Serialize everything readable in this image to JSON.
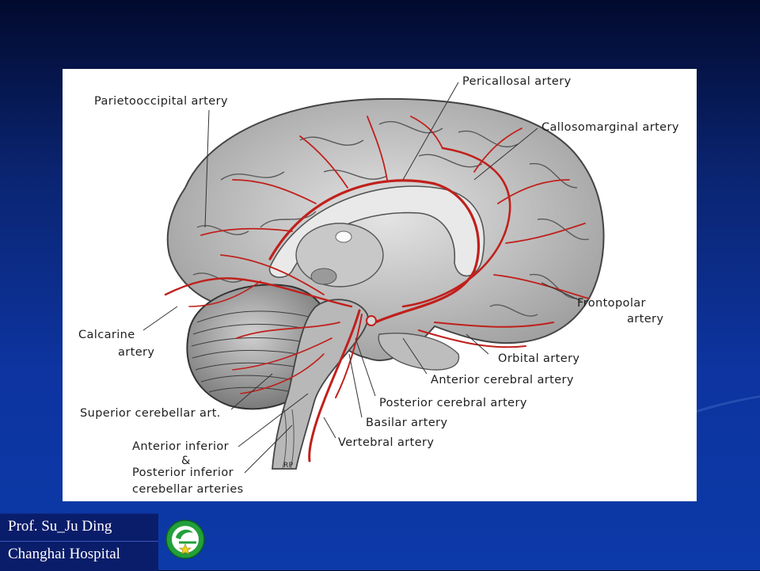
{
  "labels": {
    "pericallosal": "Pericallosal artery",
    "parietooccipital": "Parietooccipital artery",
    "callosomarginal": "Callosomarginal artery",
    "frontopolar_1": "Frontopolar",
    "frontopolar_2": "artery",
    "calcarine_1": "Calcarine",
    "calcarine_2": "artery",
    "orbital": "Orbital artery",
    "anterior_cerebral": "Anterior cerebral artery",
    "posterior_cerebral": "Posterior cerebral artery",
    "superior_cerebellar": "Superior cerebellar art.",
    "basilar": "Basilar artery",
    "anterior_inferior": "Anterior inferior",
    "ampersand": "&",
    "vertebral": "Vertebral artery",
    "posterior_inferior": "Posterior inferior",
    "cerebellar_arteries": "cerebellar arteries",
    "signature": "RP"
  },
  "credit": {
    "line1": "Prof. Su_Ju Ding",
    "line2": "Changhai Hospital"
  },
  "colors": {
    "artery": "#c0201c",
    "brain_fill": "#cfcfcf",
    "background": "#0c3aa8",
    "logo_green": "#22a03a",
    "logo_star": "#f2d21a"
  },
  "logo_icon": "hospital-emblem-icon"
}
